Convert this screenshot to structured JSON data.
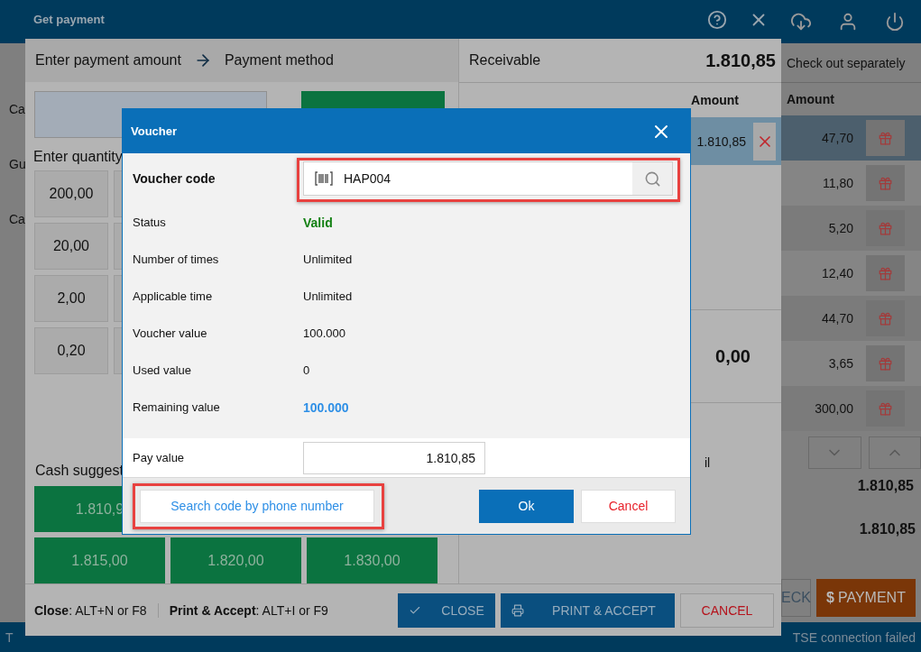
{
  "app": {
    "left_fragments": [
      "Ca",
      "Gu",
      "Ca"
    ],
    "status_fragment": "T",
    "status_text": "TSE connection failed"
  },
  "split_panel": {
    "title": "Check out separately",
    "column": "Amount",
    "rows": [
      {
        "amount": "47,70",
        "selected": true
      },
      {
        "amount": "11,80",
        "selected": false
      },
      {
        "amount": "5,20",
        "selected": false
      },
      {
        "amount": "12,40",
        "selected": false
      },
      {
        "amount": "44,70",
        "selected": false
      },
      {
        "amount": "3,65",
        "selected": false
      },
      {
        "amount": "300,00",
        "selected": false
      }
    ],
    "totals": [
      "1.810,85",
      "1.810,85"
    ],
    "buttons": [
      {
        "label": "ECK",
        "kind": "plain"
      },
      {
        "label": "PAYMENT",
        "icon": "$",
        "kind": "primary"
      }
    ]
  },
  "payment_dialog": {
    "title": "Get payment",
    "steps": [
      "Enter payment amount",
      "Payment method"
    ],
    "quantity_label": "Enter quantity",
    "quantities": [
      "200,00",
      "20,00",
      "2,00",
      "0,20"
    ],
    "cash_label": "Cash suggest",
    "cash_suggestions": [
      "1.810,9",
      "1.815,00",
      "1.820,00",
      "1.830,00"
    ],
    "shortcuts": [
      "**Close**: ALT+N or F8",
      "**Print & Accept**: ALT+I or F9"
    ],
    "buttons": [
      {
        "label": "CLOSE",
        "kind": "close"
      },
      {
        "label": "PRINT & ACCEPT",
        "kind": "print"
      },
      {
        "label": "CANCEL",
        "kind": "cancel"
      }
    ],
    "receivable": {
      "label": "Receivable",
      "value": "1.810,85"
    },
    "amount_column": "Amount",
    "payments": [
      {
        "amount": "1.810,85",
        "selected": true
      }
    ],
    "balance": "0,00",
    "fragment": "il"
  },
  "voucher": {
    "title": "Voucher",
    "code_label": "Voucher code",
    "code": "HAP004",
    "code_highlighted": true,
    "details": [
      {
        "label": "Status",
        "value": "Valid",
        "kind": "status"
      },
      {
        "label": "Number of times",
        "value": "Unlimited",
        "kind": "plain"
      },
      {
        "label": "Applicable time",
        "value": "Unlimited",
        "kind": "plain"
      },
      {
        "label": "Voucher value",
        "value": "100.000",
        "kind": "plain"
      },
      {
        "label": "Used value",
        "value": "0",
        "kind": "plain"
      },
      {
        "label": "Remaining value",
        "value": "100.000",
        "kind": "amount"
      }
    ],
    "pay_label": "Pay value",
    "pay_value": "1.810,85",
    "buttons": [
      {
        "label": "Search code by phone number",
        "kind": "link",
        "highlighted": true
      },
      {
        "label": "Ok",
        "kind": "primary",
        "highlighted": false
      },
      {
        "label": "Cancel",
        "kind": "cancel",
        "highlighted": false
      }
    ]
  }
}
